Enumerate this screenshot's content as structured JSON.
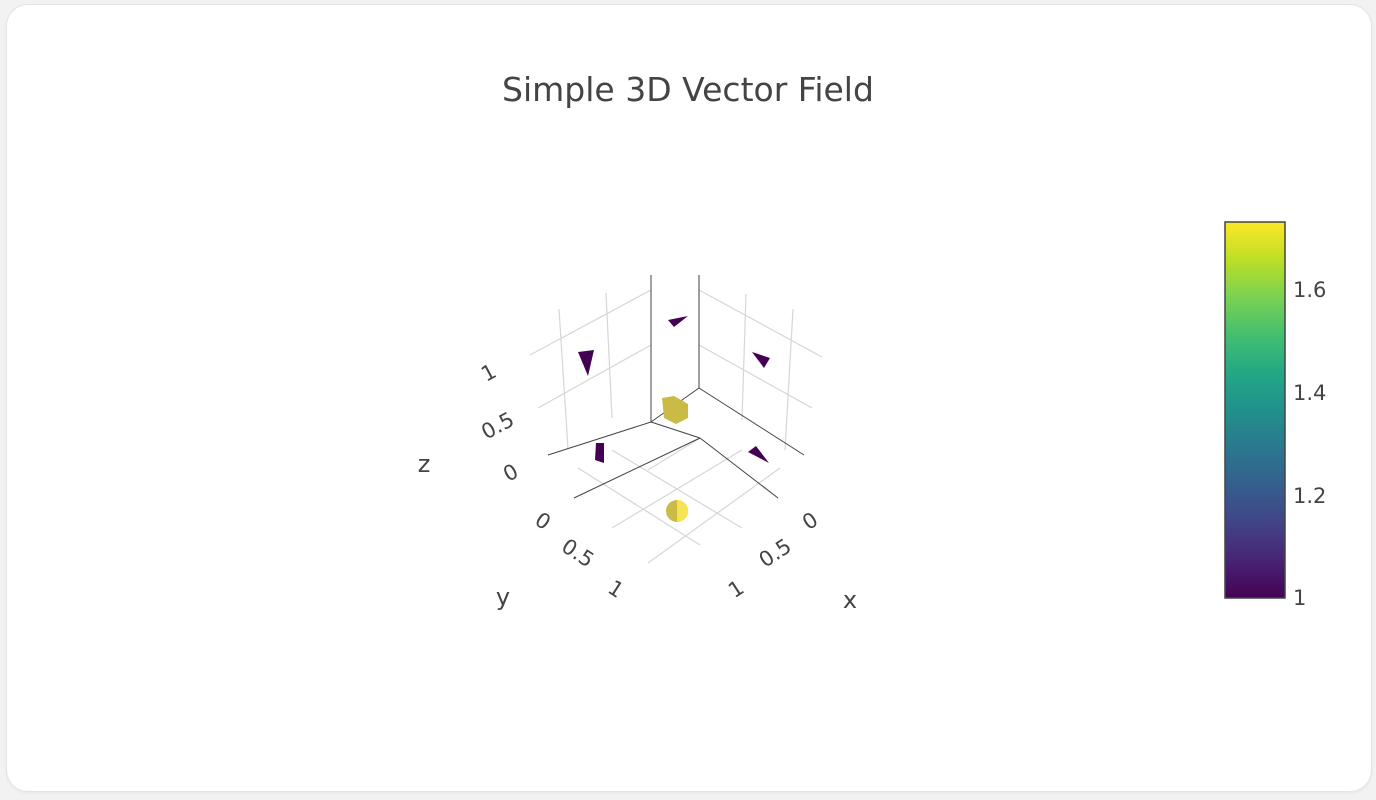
{
  "chart_data": {
    "type": "cone",
    "title": "Simple 3D Vector Field",
    "axes": {
      "x": {
        "title": "x",
        "ticks": [
          "0",
          "0.5",
          "1"
        ],
        "range": [
          0,
          1
        ]
      },
      "y": {
        "title": "y",
        "ticks": [
          "0",
          "0.5",
          "1"
        ],
        "range": [
          0,
          1
        ]
      },
      "z": {
        "title": "z",
        "ticks": [
          "0",
          "0.5",
          "1"
        ],
        "range": [
          0,
          1
        ]
      }
    },
    "cones": [
      {
        "x": 0,
        "y": 0,
        "z": 0,
        "u": 1,
        "v": 1,
        "w": 1,
        "norm": 1.732
      },
      {
        "x": 1,
        "y": 0,
        "z": 0,
        "u": 0,
        "v": 1,
        "w": 0,
        "norm": 1
      },
      {
        "x": 0,
        "y": 1,
        "z": 0,
        "u": 1,
        "v": 0,
        "w": 0,
        "norm": 1
      },
      {
        "x": 1,
        "y": 1,
        "z": 0,
        "u": 1,
        "v": 1,
        "w": 1,
        "norm": 1.732
      },
      {
        "x": 0,
        "y": 0,
        "z": 1,
        "u": -1,
        "v": 0,
        "w": 0,
        "norm": 1
      },
      {
        "x": 1,
        "y": 0,
        "z": 1,
        "u": 0,
        "v": 0,
        "w": -1,
        "norm": 1
      },
      {
        "x": 0,
        "y": 1,
        "z": 1,
        "u": 0,
        "v": 0,
        "w": -1,
        "norm": 1
      }
    ],
    "colorscale": "Viridis",
    "colorbar": {
      "ticks": [
        "1",
        "1.2",
        "1.4",
        "1.6"
      ],
      "min": 1,
      "max": 1.732
    },
    "colors": {
      "low": "#440154",
      "high": "#fde725",
      "axis_line": "#444444",
      "grid": "#d6d6d6",
      "text": "#444444"
    }
  }
}
